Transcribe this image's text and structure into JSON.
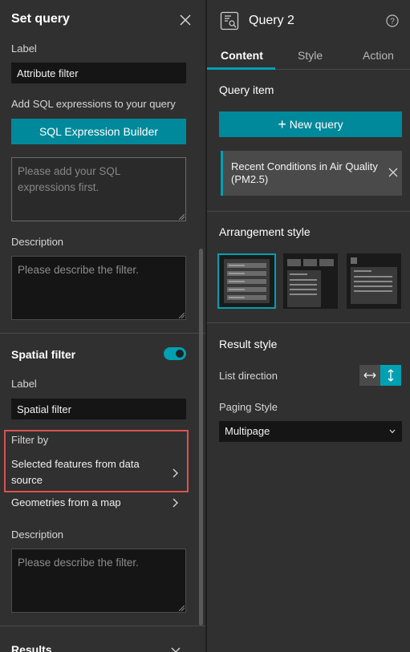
{
  "left_panel": {
    "title": "Set query",
    "attribute_filter": {
      "label_caption": "Label",
      "label_value": "Attribute filter",
      "sql_caption": "Add SQL expressions to your query",
      "sql_button": "SQL Expression Builder",
      "sql_placeholder": "Please add your SQL expressions first.",
      "description_caption": "Description",
      "description_placeholder": "Please describe the filter."
    },
    "spatial_filter": {
      "title": "Spatial filter",
      "enabled": true,
      "label_caption": "Label",
      "label_value": "Spatial filter",
      "filter_by_caption": "Filter by",
      "options": [
        "Selected features from data source",
        "Geometries from a map"
      ],
      "description_caption": "Description",
      "description_placeholder": "Please describe the filter."
    },
    "results": {
      "title": "Results"
    }
  },
  "right_panel": {
    "widget_title": "Query 2",
    "tabs": [
      {
        "label": "Content",
        "active": true
      },
      {
        "label": "Style",
        "active": false
      },
      {
        "label": "Action",
        "active": false
      }
    ],
    "query_item": {
      "title": "Query item",
      "new_button": "New query",
      "items": [
        "Recent Conditions in Air Quality (PM2.5)"
      ]
    },
    "arrangement": {
      "title": "Arrangement style",
      "options": [
        "list",
        "tabs",
        "popover"
      ],
      "selected": 0
    },
    "result_style": {
      "title": "Result style",
      "list_direction_label": "List direction",
      "list_direction_options": [
        "horizontal",
        "vertical"
      ],
      "list_direction_selected": "vertical",
      "paging_label": "Paging Style",
      "paging_value": "Multipage"
    }
  },
  "colors": {
    "accent": "#00a0b3",
    "button": "#00899b",
    "highlight_box": "#d9534f",
    "panel_bg": "#303030",
    "input_bg": "#151515"
  },
  "icons": {
    "close": "close-icon",
    "help": "help-icon",
    "widget": "query-widget-icon",
    "chevron": "chevron-right-icon"
  }
}
